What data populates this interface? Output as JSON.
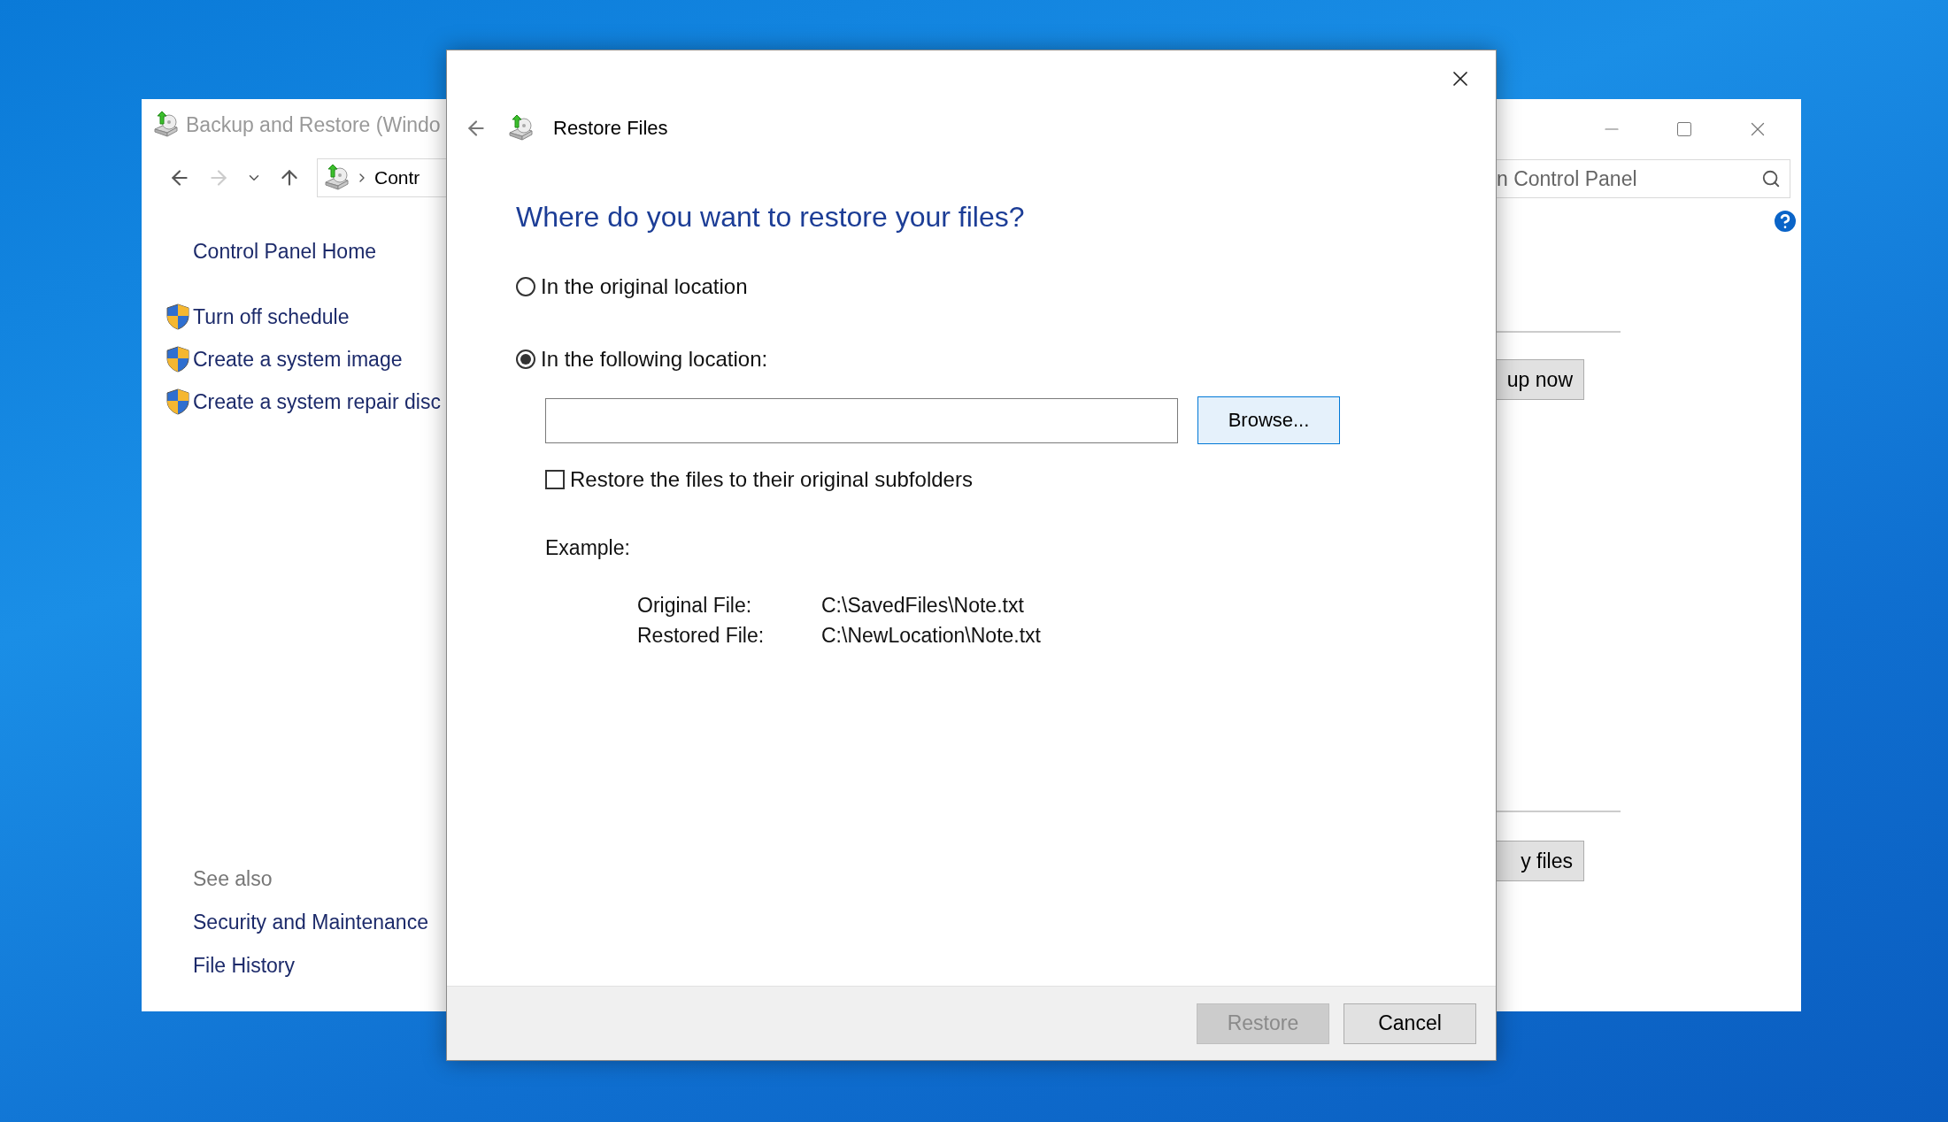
{
  "background_window": {
    "title": "Backup and Restore (Windo",
    "address_crumb": "Contr",
    "search": {
      "placeholder": "n Control Panel"
    },
    "sidebar": {
      "home": "Control Panel Home",
      "tasks": [
        "Turn off schedule",
        "Create a system image",
        "Create a system repair disc"
      ],
      "see_also_heading": "See also",
      "see_also": [
        "Security and Maintenance",
        "File History"
      ]
    },
    "buttons": [
      "up now",
      "y files"
    ]
  },
  "dialog": {
    "title": "Restore Files",
    "heading": "Where do you want to restore your files?",
    "options": [
      {
        "label": "In the original location",
        "selected": false
      },
      {
        "label": "In the following location:",
        "selected": true
      }
    ],
    "browse": "Browse...",
    "subfolders": {
      "label": "Restore the files to their original subfolders",
      "checked": false
    },
    "example": {
      "heading": "Example:",
      "rows": [
        {
          "label": "Original File:",
          "value": "C:\\SavedFiles\\Note.txt"
        },
        {
          "label": "Restored File:",
          "value": "C:\\NewLocation\\Note.txt"
        }
      ]
    },
    "buttons": [
      {
        "label": "Restore",
        "disabled": true
      },
      {
        "label": "Cancel",
        "disabled": false
      }
    ]
  }
}
